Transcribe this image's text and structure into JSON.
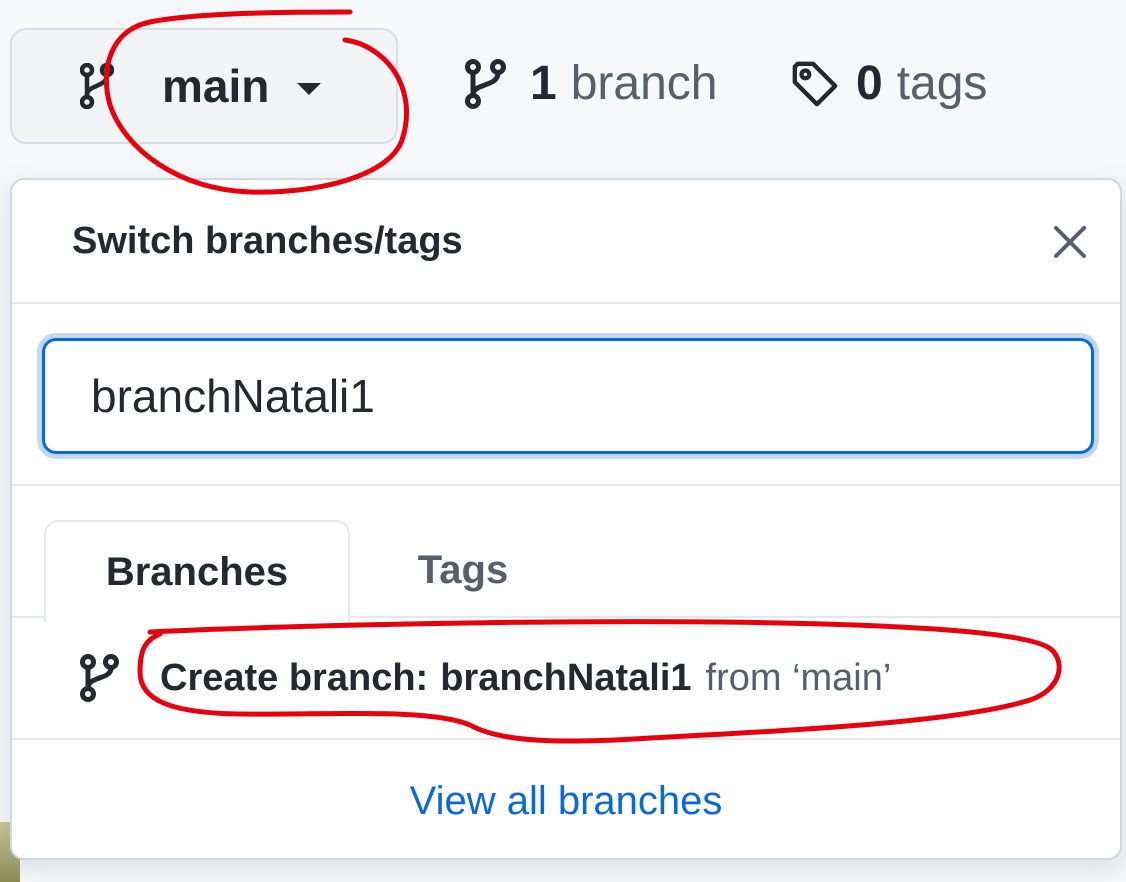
{
  "header": {
    "current_branch": "main",
    "branches_count": "1",
    "branches_label": "branch",
    "tags_count": "0",
    "tags_label": "tags"
  },
  "dropdown": {
    "title": "Switch branches/tags",
    "filter_value": "branchNatali1",
    "tabs": [
      {
        "label": "Branches",
        "active": true
      },
      {
        "label": "Tags",
        "active": false
      }
    ],
    "create": {
      "prefix": "Create branch:",
      "name": "branchNatali1",
      "suffix": "from ‘main’"
    },
    "view_all": "View all branches"
  },
  "icons": {
    "branch": "git-branch-icon",
    "tag": "tag-icon",
    "close": "close-icon",
    "caret": "caret-down-icon"
  },
  "colors": {
    "accent": "#0969da",
    "annotation": "#e8000b",
    "text": "#24292f",
    "muted": "#57606a"
  }
}
